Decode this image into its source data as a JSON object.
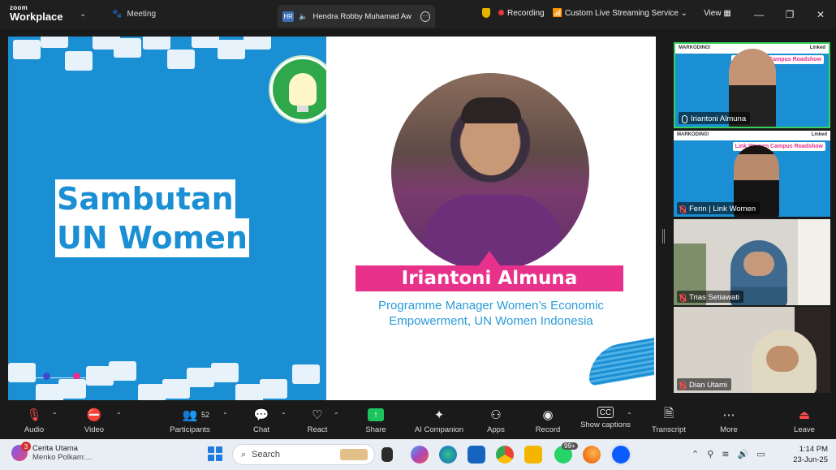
{
  "titlebar": {
    "brand_small": "zoom",
    "brand_large": "Workplace",
    "meeting_label": "Meeting",
    "tab_initials": "HR",
    "tab_name": "Hendra Robby Muhamad Aw",
    "recording_label": "Recording",
    "streaming_label": "Custom Live Streaming Service",
    "view_label": "View"
  },
  "slide": {
    "title_line1": "Sambutan",
    "title_line2": "UN Women",
    "speaker_name": "Iriantoni Almuna",
    "role_line1": "Programme Manager Women’s Economic",
    "role_line2": "Empowerment, UN Women Indonesia",
    "dot_colors": [
      "#1b8fd3",
      "#3c4bd6",
      "#e8318a",
      "#e84a4a"
    ]
  },
  "gallery": {
    "banner_left": "MARKODING!",
    "banner_right": "Linked",
    "banner_tag": "Link Women Campus Roadshow",
    "participants": [
      {
        "name": "Iriantoni Almuna",
        "muted": false
      },
      {
        "name": "Ferin | Link Women",
        "muted": true
      },
      {
        "name": "Trias Setiawati",
        "muted": true
      },
      {
        "name": "Dian Utami",
        "muted": true
      }
    ]
  },
  "toolbar": {
    "audio": "Audio",
    "video": "Video",
    "participants": "Participants",
    "participants_count": "52",
    "chat": "Chat",
    "react": "React",
    "share": "Share",
    "ai_companion": "AI Companion",
    "apps": "Apps",
    "record": "Record",
    "show_captions": "Show captions",
    "transcript": "Transcript",
    "more": "More",
    "leave": "Leave"
  },
  "taskbar": {
    "news_badge": "3",
    "news_title": "Cerita Utama",
    "news_sub": "Menko Polkam:...",
    "search_placeholder": "Search",
    "whatsapp_badge": "99+",
    "time": "1:14 PM",
    "date": "23-Jun-25"
  }
}
